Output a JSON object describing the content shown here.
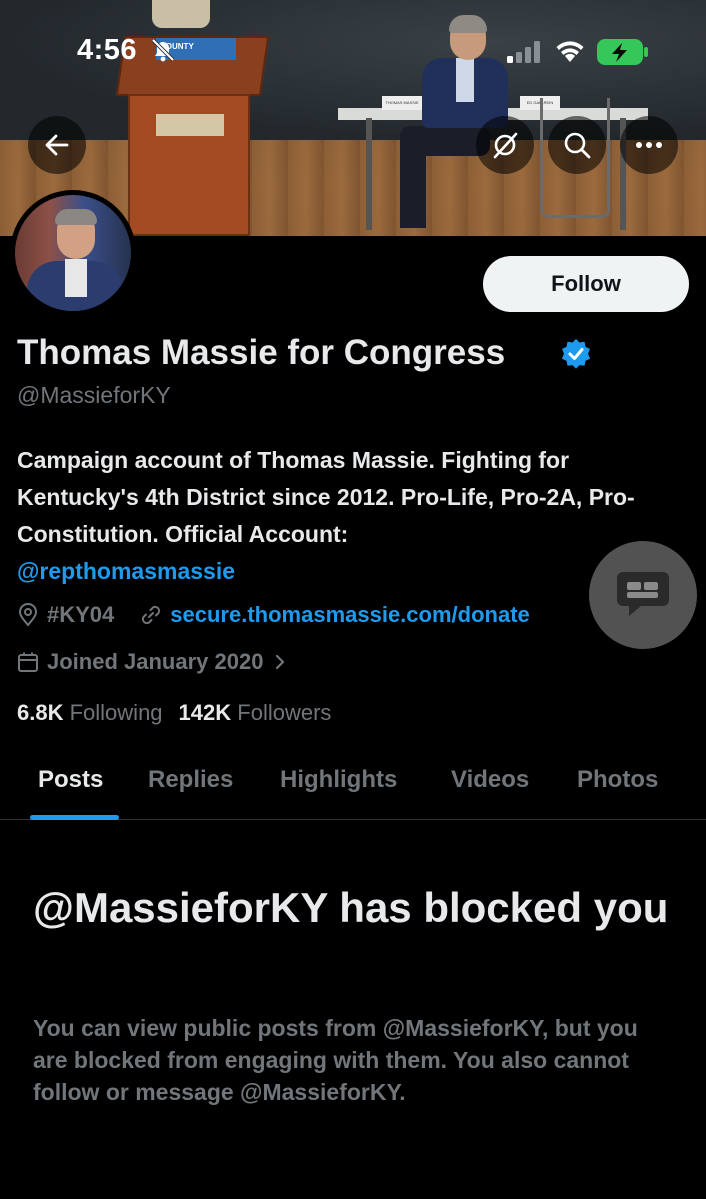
{
  "status_bar": {
    "time": "4:56"
  },
  "banner": {
    "podium_sign": "COUNTY",
    "nameplate_left": "THOMAS MASSIE",
    "nameplate_right": "ED GALLREIN"
  },
  "profile": {
    "display_name": "Thomas Massie for Congress",
    "handle": "@MassieforKY",
    "bio_text": "Campaign account of Thomas Massie. Fighting for Kentucky's 4th District since 2012. Pro-Life, Pro-2A, Pro-Constitution. Official Account:",
    "bio_mention": "@repthomasmassie",
    "location": "#KY04",
    "website": "secure.thomasmassie.com/donate",
    "joined": "Joined January 2020",
    "following_count": "6.8K",
    "following_label": "Following",
    "followers_count": "142K",
    "followers_label": "Followers"
  },
  "actions": {
    "follow_label": "Follow"
  },
  "tabs": [
    {
      "label": "Posts",
      "active": true
    },
    {
      "label": "Replies",
      "active": false
    },
    {
      "label": "Highlights",
      "active": false
    },
    {
      "label": "Videos",
      "active": false
    },
    {
      "label": "Photos",
      "active": false
    }
  ],
  "blocked": {
    "title": "@MassieforKY has blocked you",
    "body": "You can view public posts from @MassieforKY, but you are blocked from engaging with them. You also cannot follow or message @MassieforKY."
  },
  "colors": {
    "background": "#000000",
    "accent": "#1d9bf0",
    "muted_text": "#71767b",
    "primary_text": "#e7e9ea"
  },
  "icons": [
    "back-arrow-icon",
    "grok-icon",
    "search-icon",
    "more-icon",
    "verified-icon",
    "location-icon",
    "link-icon",
    "calendar-icon",
    "chevron-right-icon",
    "chat-icon",
    "bell-off-icon",
    "signal-icon",
    "wifi-icon",
    "battery-icon"
  ]
}
